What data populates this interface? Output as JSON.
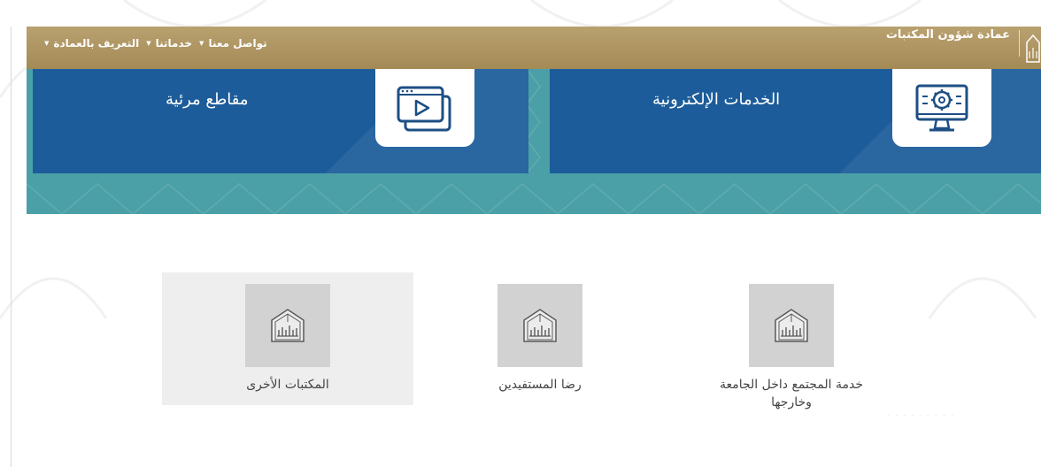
{
  "header": {
    "brand_title": "عمادة شؤون المكتبات",
    "nav": [
      {
        "label": "التعريف بالعمادة"
      },
      {
        "label": "خدماتنا"
      },
      {
        "label": "تواصل معنا"
      }
    ]
  },
  "tiles": [
    {
      "label": "الخدمات الإلكترونية",
      "icon": "monitor-gear-icon"
    },
    {
      "label": "مقاطع مرئية",
      "icon": "video-play-icon"
    }
  ],
  "cards": [
    {
      "label": "خدمة المجتمع داخل الجامعة وخارجها",
      "icon": "university-logo-icon"
    },
    {
      "label": "رضا المستفيدين",
      "icon": "university-logo-icon"
    },
    {
      "label": "المكتبات الأخرى",
      "icon": "university-logo-icon"
    }
  ],
  "colors": {
    "navbar": "#a89060",
    "tile": "#1d5c9a",
    "teal": "#4aa0a6",
    "card_placeholder": "#d2d2d2"
  }
}
